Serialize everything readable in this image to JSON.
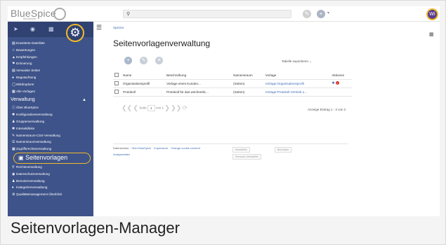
{
  "header": {
    "logo_text": "BlueSpice",
    "logo_sub": "MediaWiki",
    "search_icon": "search-icon",
    "avatar_initials": "Wi"
  },
  "sidebar": {
    "top_items": [
      {
        "icon": "list-icon",
        "label": "Erweiterte Dateiliste"
      },
      {
        "icon": "star-icon",
        "label": "Bewertungen"
      },
      {
        "icon": "thumb-icon",
        "label": "Empfehlungen"
      },
      {
        "icon": "flag-icon",
        "label": "Erinnerung"
      },
      {
        "icon": "list-icon",
        "label": "Verwaiste Seiten"
      },
      {
        "icon": "circle-icon",
        "label": "Begutachtung"
      },
      {
        "icon": "compass-icon",
        "label": "WikiExplorer"
      },
      {
        "icon": "grid-icon",
        "label": "Alle Vorlagen"
      }
    ],
    "section_title": "Verwaltung",
    "admin_items": [
      {
        "icon": "info-icon",
        "label": "Über BlueSpice"
      },
      {
        "icon": "wrench-icon",
        "label": "Konfigurationsverwaltung"
      },
      {
        "icon": "users-icon",
        "label": "Gruppenverwaltung"
      },
      {
        "icon": "wrench-icon",
        "label": "Interwikilinks"
      },
      {
        "icon": "brush-icon",
        "label": "Namensraum-CSS-Verwaltung"
      },
      {
        "icon": "layers-icon",
        "label": "Namensraumverwaltung"
      },
      {
        "icon": "grid-icon",
        "label": "Zugriffsrechteverwaltung"
      }
    ],
    "active_item": "Seitenvorlagen",
    "bottom_items": [
      {
        "icon": "key-icon",
        "label": "Rechteverwaltung"
      },
      {
        "icon": "eye-icon",
        "label": "Datenschutzverwaltung"
      },
      {
        "icon": "user-icon",
        "label": "Benutzerverwaltung"
      },
      {
        "icon": "tag-icon",
        "label": "Kategorienverwaltung"
      },
      {
        "icon": "gear-icon",
        "label": "Qualitätsmanagement Überblick"
      }
    ]
  },
  "main": {
    "breadcrumb": "Spezial",
    "title": "Seitenvorlagenverwaltung",
    "export_label": "Tabelle exportieren",
    "columns": [
      "Name",
      "Beschreibung",
      "Namensraum",
      "Vorlage",
      "Aktionen"
    ],
    "rows": [
      {
        "name": "Organisationsprofil",
        "description": "Vorlage eines Kunden...",
        "namespace": "(Seiten)",
        "template": "Vorlage:Organisationsprofil"
      },
      {
        "name": "Protokoll",
        "description": "Protokoll für das wöchentlic...",
        "namespace": "(Seiten)",
        "template": "Vorlage:Protokoll Vertrieb u..."
      }
    ],
    "pager": {
      "page_label": "Seite",
      "page_value": "1",
      "of_label": "von 1"
    },
    "count_label": "Anzeige Eintrag 1 - 2 von 2"
  },
  "footer": {
    "links": [
      "Datenschutz",
      "Über BlueSpice",
      "Impressum",
      "Change cookie consent"
    ],
    "analytics": "Analysedaten",
    "badges": [
      "MediaWiki",
      "BlueSpice",
      "Semantic MediaWiki"
    ]
  },
  "caption": "Seitenvorlagen-Manager",
  "colors": {
    "sidebar": "#3e5389",
    "highlight": "#f2b92b",
    "link": "#3e6fb5"
  }
}
